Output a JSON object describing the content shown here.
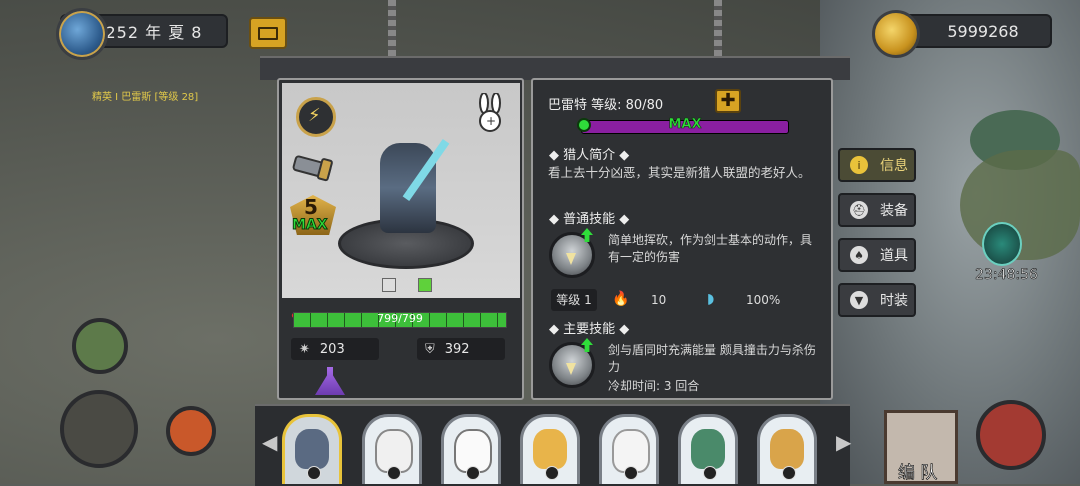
{
  "header": {
    "date": "252 年 夏 8",
    "gold": "5999268"
  },
  "map": {
    "enemy_label": "精英 I 巴雷斯 [等级 28]",
    "timer": "23:48:56"
  },
  "hero": {
    "rank": "5",
    "max_label": "MAX",
    "hp": "799/799",
    "hp_fraction": 1.0,
    "attack": "203",
    "defense": "392"
  },
  "info": {
    "name_level": "巴雷特  等级: 80/80",
    "level_bar_label": "MAX",
    "intro_title": "猎人简介",
    "intro_text": "看上去十分凶恶，其实是新猎人联盟的老好人。",
    "normal_skill_title": "普通技能",
    "normal_skill_text": "简单地挥砍，作为剑士基本的动作，具有一定的伤害",
    "skill_level": "等级 1",
    "fire_value": "10",
    "wind_value": "100%",
    "main_skill_title": "主要技能",
    "main_skill_text": "剑与盾同时充满能量 颇具撞击力与杀伤力",
    "cooldown": "冷却时间: 3 回合"
  },
  "tabs": [
    {
      "label": "信息",
      "icon": "info-icon",
      "active": true
    },
    {
      "label": "装备",
      "icon": "helmet-icon",
      "active": false
    },
    {
      "label": "道具",
      "icon": "bag-icon",
      "active": false
    },
    {
      "label": "时装",
      "icon": "shirt-icon",
      "active": false
    }
  ],
  "bottom": {
    "team_label": "编 队"
  },
  "colors": {
    "accent_gold": "#d7a323",
    "panel_bg": "#2e3033",
    "hp_green": "#3dbf3a",
    "level_bar_purple": "#8a1fa1"
  }
}
